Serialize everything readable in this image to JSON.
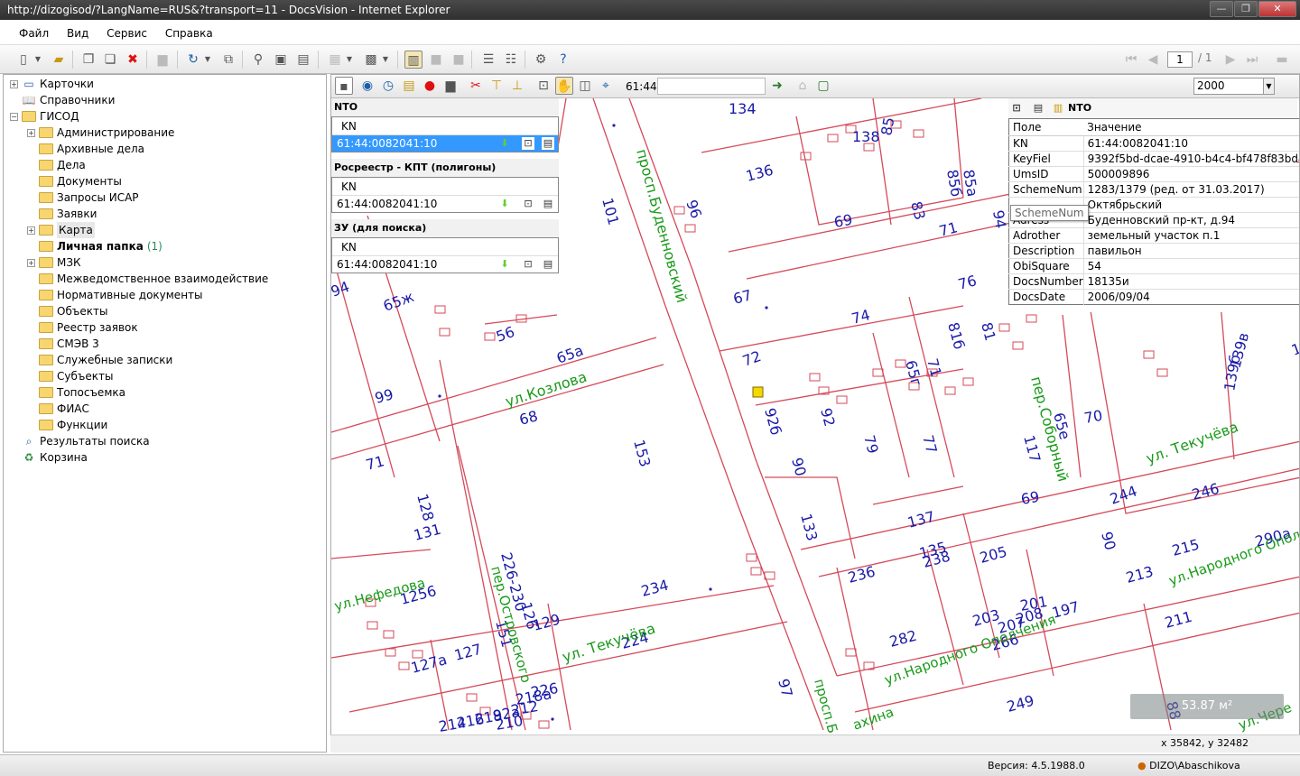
{
  "window": {
    "title": "http://dizogisod/?LangName=RUS&?transport=11 - DocsVision - Internet Explorer"
  },
  "menu": [
    "Файл",
    "Вид",
    "Сервис",
    "Справка"
  ],
  "pager": {
    "current": "1",
    "total": "/ 1"
  },
  "tree": {
    "items": [
      {
        "label": "Карточки",
        "icon": "cards-icon",
        "level": 0,
        "toggle": "+",
        "count": ""
      },
      {
        "label": "Справочники",
        "icon": "book-icon",
        "level": 0,
        "toggle": "",
        "count": ""
      },
      {
        "label": "ГИСОД",
        "icon": "folder-icon",
        "level": 0,
        "toggle": "−",
        "count": ""
      },
      {
        "label": "Администрирование",
        "icon": "folder-icon",
        "level": 1,
        "toggle": "+",
        "count": ""
      },
      {
        "label": "Архивные дела",
        "icon": "folder-icon",
        "level": 1,
        "toggle": "",
        "count": ""
      },
      {
        "label": "Дела",
        "icon": "folder-icon",
        "level": 1,
        "toggle": "",
        "count": ""
      },
      {
        "label": "Документы",
        "icon": "folder-icon",
        "level": 1,
        "toggle": "",
        "count": ""
      },
      {
        "label": "Запросы ИСАР",
        "icon": "folder-icon",
        "level": 1,
        "toggle": "",
        "count": ""
      },
      {
        "label": "Заявки",
        "icon": "folder-icon",
        "level": 1,
        "toggle": "",
        "count": ""
      },
      {
        "label": "Карта",
        "icon": "folder-open-icon",
        "level": 1,
        "toggle": "+",
        "count": "",
        "selected": true
      },
      {
        "label": "Личная папка",
        "icon": "folder-icon",
        "level": 1,
        "toggle": "",
        "count": "(1)",
        "bold": true
      },
      {
        "label": "МЗК",
        "icon": "folder-icon",
        "level": 1,
        "toggle": "+",
        "count": ""
      },
      {
        "label": "Межведомственное взаимодействие",
        "icon": "folder-icon",
        "level": 1,
        "toggle": "",
        "count": ""
      },
      {
        "label": "Нормативные документы",
        "icon": "folder-icon",
        "level": 1,
        "toggle": "",
        "count": ""
      },
      {
        "label": "Объекты",
        "icon": "folder-icon",
        "level": 1,
        "toggle": "",
        "count": ""
      },
      {
        "label": "Реестр заявок",
        "icon": "folder-icon",
        "level": 1,
        "toggle": "",
        "count": ""
      },
      {
        "label": "СМЭВ 3",
        "icon": "folder-icon",
        "level": 1,
        "toggle": "",
        "count": ""
      },
      {
        "label": "Служебные записки",
        "icon": "folder-icon",
        "level": 1,
        "toggle": "",
        "count": ""
      },
      {
        "label": "Субъекты",
        "icon": "folder-icon",
        "level": 1,
        "toggle": "",
        "count": ""
      },
      {
        "label": "Топосъемка",
        "icon": "folder-icon",
        "level": 1,
        "toggle": "",
        "count": ""
      },
      {
        "label": "ФИАС",
        "icon": "folder-icon",
        "level": 1,
        "toggle": "",
        "count": ""
      },
      {
        "label": "Функции",
        "icon": "folder-icon",
        "level": 1,
        "toggle": "",
        "count": ""
      },
      {
        "label": "Результаты поиска",
        "icon": "search-results-icon",
        "level": 0,
        "toggle": "",
        "count": ""
      },
      {
        "label": "Корзина",
        "icon": "recycle-bin-icon",
        "level": 0,
        "toggle": "",
        "count": ""
      }
    ]
  },
  "map_toolbar": {
    "coord_prefix": "61:44:",
    "coord_value": "",
    "scale": "2000"
  },
  "layers": [
    {
      "title": "NTO",
      "column": "KN",
      "value": "61:44:0082041:10",
      "selected": true
    },
    {
      "title": "Росреестр - КПТ (полигоны)",
      "column": "KN",
      "value": "61:44:0082041:10",
      "selected": false
    },
    {
      "title": "ЗУ (для поиска)",
      "column": "KN",
      "value": "61:44:0082041:10",
      "selected": false
    }
  ],
  "attributes": {
    "title": "NTO",
    "col_field": "Поле",
    "col_value": "Значение",
    "rows": [
      {
        "field": "KN",
        "value": "61:44:0082041:10"
      },
      {
        "field": "KeyFiel",
        "value": "9392f5bd-dcae-4910-b4c4-bf478f83bd4e"
      },
      {
        "field": "UmsID",
        "value": "500009896"
      },
      {
        "field": "SchemeNum",
        "value": "1283/1379 (ред. от 31.03.2017)"
      },
      {
        "field": "",
        "value": "Октябрьский"
      },
      {
        "field": "Adress",
        "value": "Буденновский пр-кт, д.94"
      },
      {
        "field": "Adrother",
        "value": "земельный участок п.1"
      },
      {
        "field": "Description",
        "value": "павильон"
      },
      {
        "field": "ObiSquare",
        "value": "54"
      },
      {
        "field": "DocsNumber",
        "value": "18135и"
      },
      {
        "field": "DocsDate",
        "value": "2006/09/04"
      }
    ],
    "tooltip": "SchemeNum"
  },
  "map": {
    "area_readout": "53.87 м²",
    "coord_readout": "x 35842, y 32482",
    "colors": {
      "parcel": "#d44a5a",
      "number": "#1a1aa8",
      "street": "#1a9a1a"
    },
    "streets": [
      "просп.Буденновский",
      "ул.Козлова",
      "ул. Текучёва",
      "ул. Текучёва",
      "пер.Соборный",
      "пер.Островского",
      "ул.Нефедова",
      "ул.Народного Ополчения",
      "ул.Народного Опол",
      "просп.Б",
      "ул.Чере",
      "ахина"
    ],
    "numbers": [
      "134",
      "138",
      "85",
      "136",
      "101",
      "96",
      "69",
      "83",
      "71",
      "85б",
      "85а",
      "94",
      "76",
      "67",
      "74",
      "81б",
      "81",
      "72",
      "71",
      "65г",
      "65а",
      "65ж",
      "56",
      "94",
      "92б",
      "92",
      "79",
      "77",
      "117",
      "139в",
      "139г",
      "117г",
      "139б",
      "139",
      "65е",
      "70",
      "99",
      "68",
      "153",
      "71",
      "128",
      "131",
      "226-230",
      "234",
      "236",
      "238",
      "205",
      "201",
      "203",
      "207",
      "208",
      "197",
      "282",
      "211",
      "213",
      "215",
      "290а",
      "244",
      "90",
      "246",
      "224",
      "151",
      "126",
      "129",
      "127",
      "127а",
      "1256",
      "97",
      "266",
      "249",
      "88",
      "69",
      "137",
      "135",
      "133",
      "90",
      "92а",
      "218",
      "216",
      "214",
      "212",
      "210",
      "218а",
      "226",
      "224"
    ]
  },
  "status": {
    "version": "Версия: 4.5.1988.0",
    "user": "DIZO\\Abaschikova"
  }
}
